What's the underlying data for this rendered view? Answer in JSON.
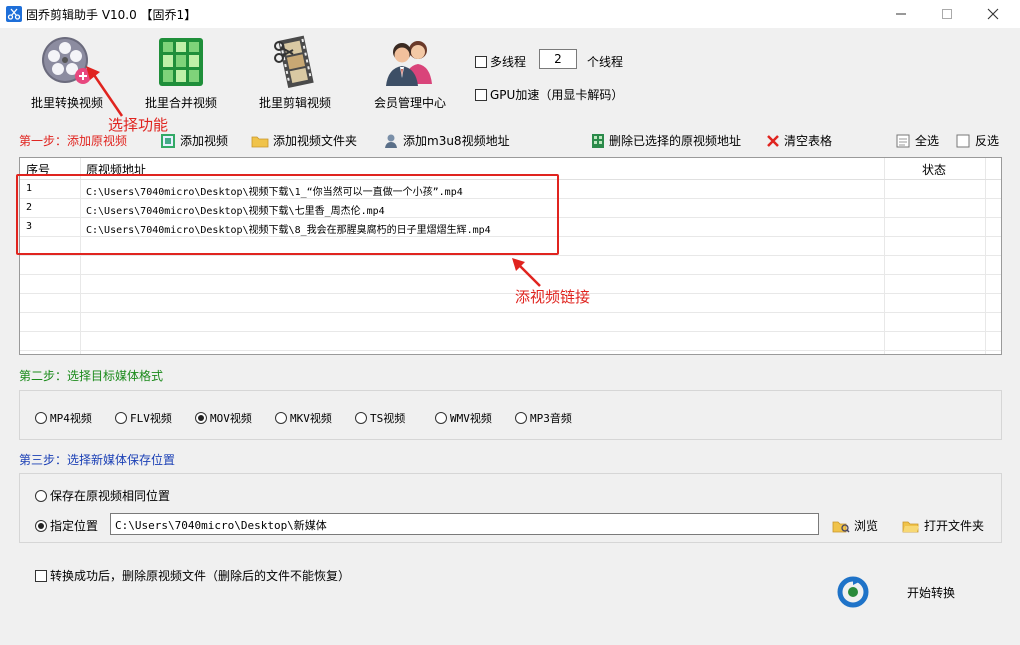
{
  "window": {
    "title": "固乔剪辑助手 V10.0  【固乔1】"
  },
  "toolbar": {
    "items": [
      {
        "label": "批里转换视频",
        "icon": "film-reel-icon"
      },
      {
        "label": "批里合并视频",
        "icon": "merge-grid-icon"
      },
      {
        "label": "批里剪辑视频",
        "icon": "film-strip-scissors-icon"
      },
      {
        "label": "会员管理中心",
        "icon": "members-icon"
      }
    ],
    "multithread_label": "多线程",
    "thread_count": "2",
    "thread_unit": "个线程",
    "gpu_label": "GPU加速（用显卡解码）"
  },
  "step1": {
    "label": "第一步：添加原视频",
    "add_video": "添加视频",
    "add_folder": "添加视频文件夹",
    "add_m3u8": "添加m3u8视频地址",
    "delete_selected": "删除已选择的原视频地址",
    "clear_table": "清空表格",
    "select_all": "全选",
    "invert": "反选"
  },
  "table": {
    "columns": [
      "序号",
      "原视频地址",
      "状态"
    ],
    "rows": [
      {
        "index": "1",
        "path": "C:\\Users\\7040micro\\Desktop\\视频下载\\1_“你当然可以一直做一个小孩”.mp4",
        "status": ""
      },
      {
        "index": "2",
        "path": "C:\\Users\\7040micro\\Desktop\\视频下载\\七里香_周杰伦.mp4",
        "status": ""
      },
      {
        "index": "3",
        "path": "C:\\Users\\7040micro\\Desktop\\视频下载\\8_我会在那腥臭腐朽的日子里熠熠生辉.mp4",
        "status": ""
      }
    ]
  },
  "step2": {
    "label": "第二步：选择目标媒体格式",
    "formats": [
      "MP4视频",
      "FLV视频",
      "MOV视频",
      "MKV视频",
      "TS视频",
      "WMV视频",
      "MP3音频"
    ],
    "selected": "MOV视频"
  },
  "step3": {
    "label": "第三步：选择新媒体保存位置",
    "same_location": "保存在原视频相同位置",
    "specify_location": "指定位置",
    "path": "C:\\Users\\7040micro\\Desktop\\新媒体",
    "browse": "浏览",
    "open_folder": "打开文件夹"
  },
  "footer": {
    "delete_after": "转换成功后，删除原视频文件（删除后的文件不能恢复）",
    "start": "开始转换"
  },
  "annotations": {
    "select_function": "选择功能",
    "add_links": "添视频链接"
  },
  "colors": {
    "step1": "#e0241f",
    "step2": "#1a8a1a",
    "step3": "#1a3fb5",
    "annotation": "#e0241f"
  }
}
